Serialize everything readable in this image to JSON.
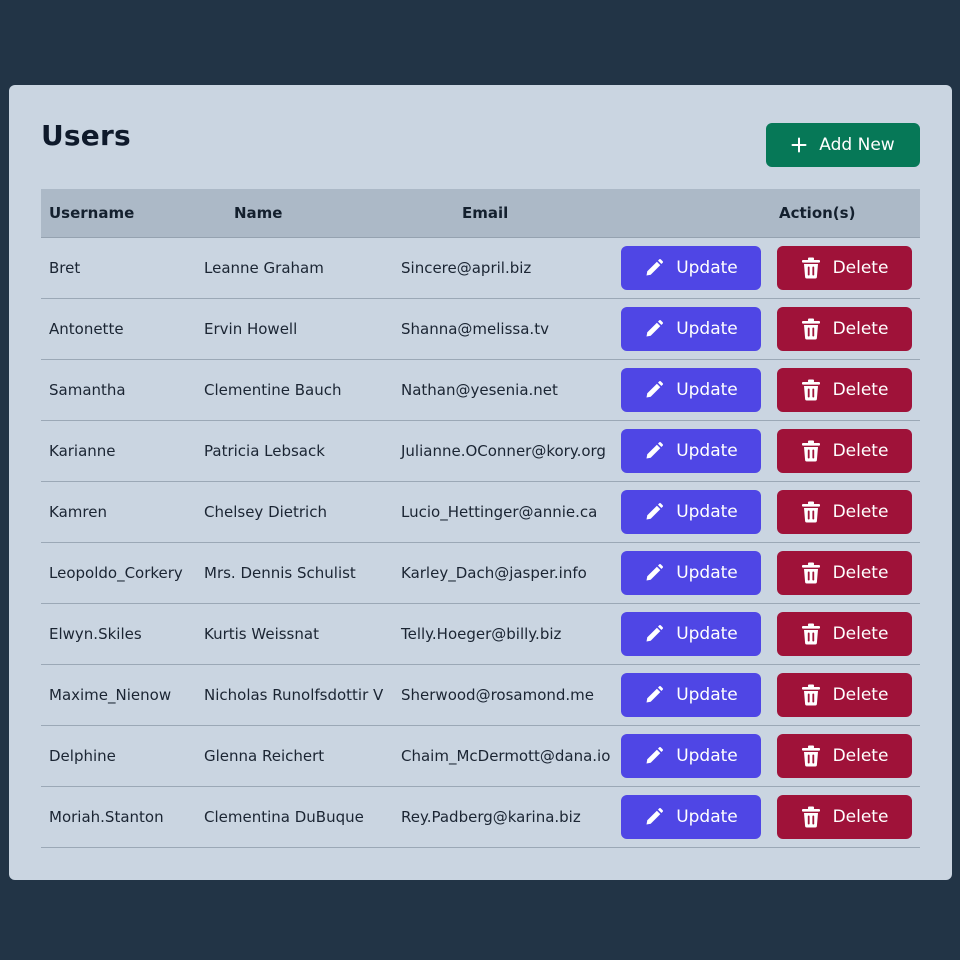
{
  "page": {
    "title": "Users",
    "add_button_label": "Add New",
    "add_icon": "plus-icon"
  },
  "table": {
    "headers": {
      "username": "Username",
      "name": "Name",
      "email": "Email",
      "actions": "Action(s)"
    },
    "update_label": "Update",
    "delete_label": "Delete",
    "update_icon": "pencil-icon",
    "delete_icon": "trash-icon",
    "rows": [
      {
        "username": "Bret",
        "name": "Leanne Graham",
        "email": "Sincere@april.biz"
      },
      {
        "username": "Antonette",
        "name": "Ervin Howell",
        "email": "Shanna@melissa.tv"
      },
      {
        "username": "Samantha",
        "name": "Clementine Bauch",
        "email": "Nathan@yesenia.net"
      },
      {
        "username": "Karianne",
        "name": "Patricia Lebsack",
        "email": "Julianne.OConner@kory.org"
      },
      {
        "username": "Kamren",
        "name": "Chelsey Dietrich",
        "email": "Lucio_Hettinger@annie.ca"
      },
      {
        "username": "Leopoldo_Corkery",
        "name": "Mrs. Dennis Schulist",
        "email": "Karley_Dach@jasper.info"
      },
      {
        "username": "Elwyn.Skiles",
        "name": "Kurtis Weissnat",
        "email": "Telly.Hoeger@billy.biz"
      },
      {
        "username": "Maxime_Nienow",
        "name": "Nicholas Runolfsdottir V",
        "email": "Sherwood@rosamond.me"
      },
      {
        "username": "Delphine",
        "name": "Glenna Reichert",
        "email": "Chaim_McDermott@dana.io"
      },
      {
        "username": "Moriah.Stanton",
        "name": "Clementina DuBuque",
        "email": "Rey.Padberg@karina.biz"
      }
    ]
  },
  "colors": {
    "background": "#223446",
    "card": "#cad5e1",
    "header_row": "#acb9c7",
    "add_button": "#067857",
    "update_button": "#4f46e5",
    "delete_button": "#9f1239"
  }
}
